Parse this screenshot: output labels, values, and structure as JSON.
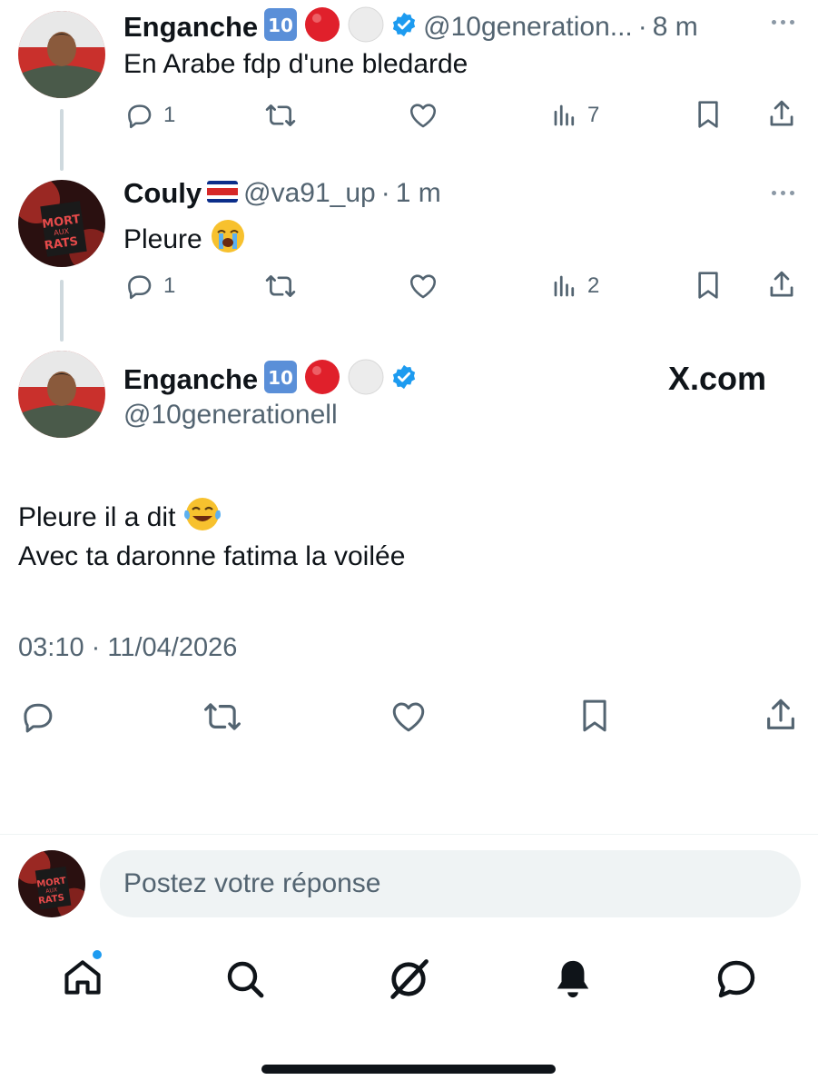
{
  "replies": [
    {
      "display_name": "Enganche",
      "handle": "@10generation...",
      "time": "8 m",
      "text": "En Arabe fdp d'une bledarde",
      "replies_count": "1",
      "views_count": "7"
    },
    {
      "display_name": "Couly",
      "handle": "@va91_up",
      "time": "1 m",
      "text": "Pleure",
      "replies_count": "1",
      "views_count": "2"
    }
  ],
  "main_tweet": {
    "display_name": "Enganche",
    "handle": "@10generationell",
    "watermark": "X.com",
    "text_line1": "Pleure il a dit",
    "text_line2": "Avec ta daronne fatima la voilée",
    "timestamp": "03:10 · 11/04/2026"
  },
  "reply_composer": {
    "placeholder": "Postez votre réponse"
  },
  "colors": {
    "text": "#0f1419",
    "secondary": "#536471",
    "verified": "#1d9bf0",
    "red_circle": "#e0202b",
    "divider": "#eff3f4",
    "composer_bg": "#eff3f4"
  },
  "bottom_nav": [
    "home-icon",
    "search-icon",
    "grok-icon",
    "notifications-icon",
    "messages-icon"
  ]
}
